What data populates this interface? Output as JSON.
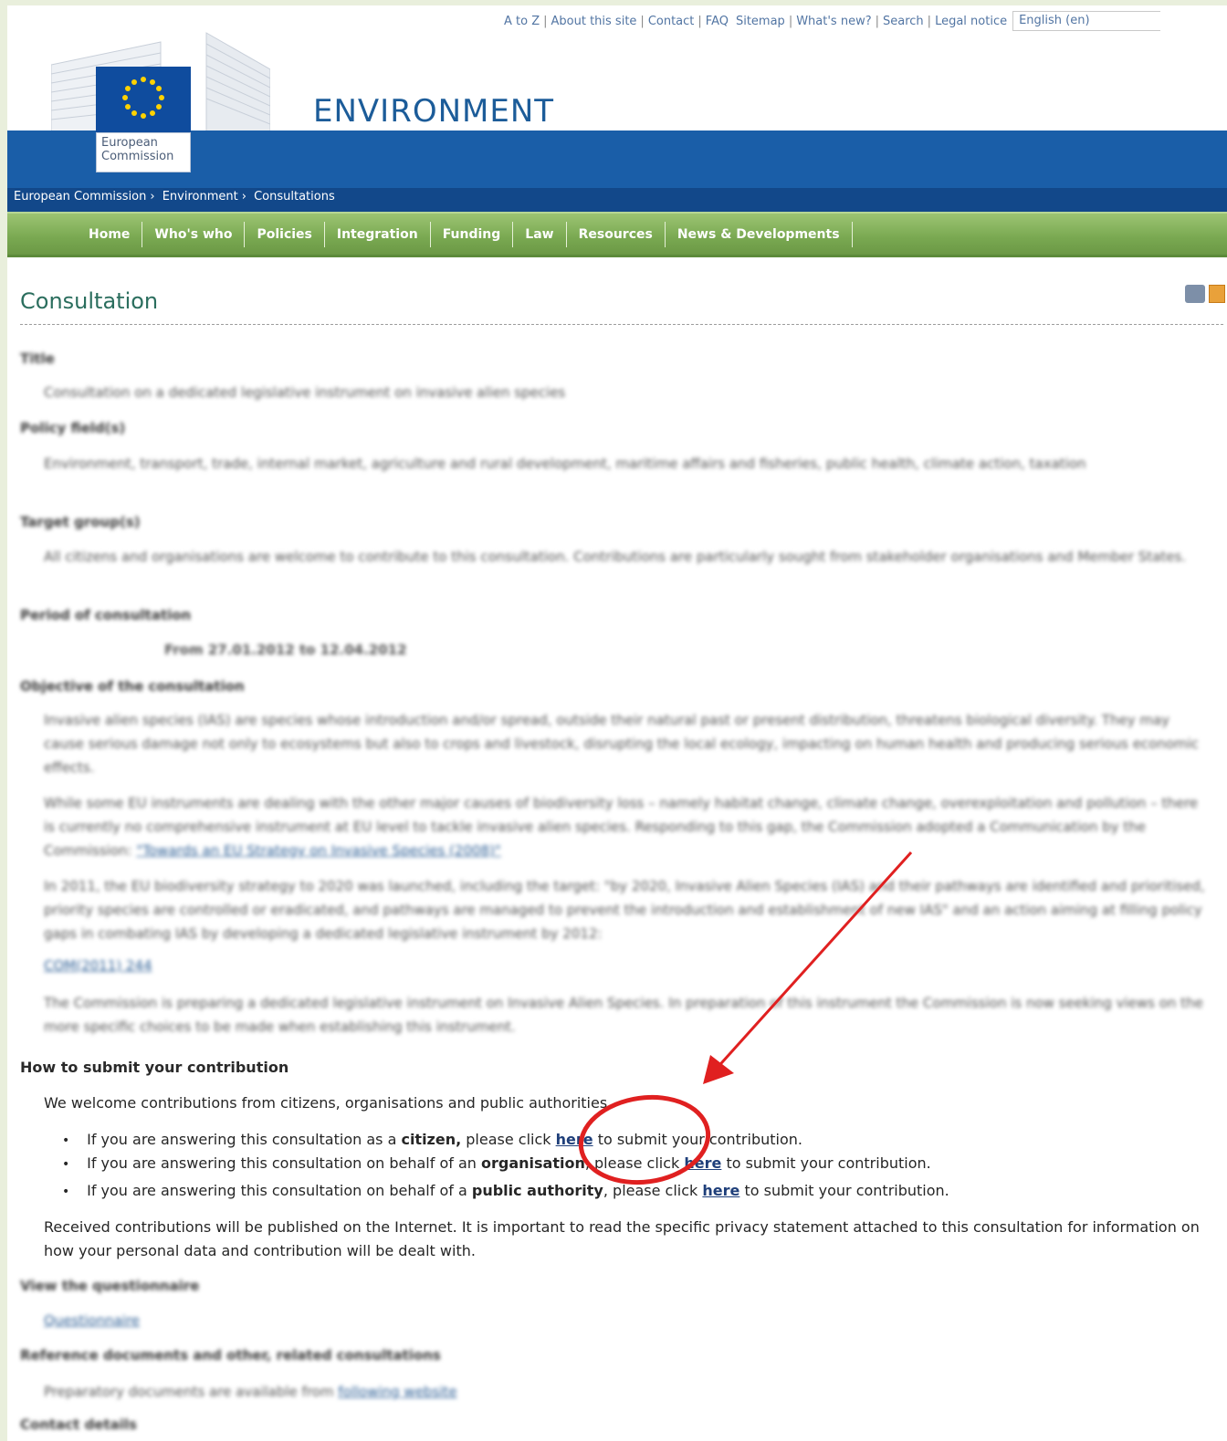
{
  "toplinks": {
    "items": [
      "A to Z",
      "About this site",
      "Contact",
      "FAQ",
      "Sitemap",
      "What's new?",
      "Search",
      "Legal notice"
    ],
    "language": "English (en)"
  },
  "header": {
    "logo_line1": "European",
    "logo_line2": "Commission",
    "site_title": "ENVIRONMENT"
  },
  "breadcrumb": [
    "European Commission",
    "Environment",
    "Consultations"
  ],
  "nav": [
    "Home",
    "Who's who",
    "Policies",
    "Integration",
    "Funding",
    "Law",
    "Resources",
    "News & Developments"
  ],
  "page": {
    "heading": "Consultation"
  },
  "blurred": {
    "title_label": "Title",
    "title_text": "Consultation on a dedicated legislative instrument on invasive alien species",
    "policy_label": "Policy field(s)",
    "policy_text": "Environment, transport, trade, internal market, agriculture and rural development, maritime affairs and fisheries, public health, climate action, taxation",
    "target_label": "Target group(s)",
    "target_text": "All citizens and organisations are welcome to contribute to this consultation. Contributions are particularly sought from stakeholder organisations and Member States.",
    "period_label": "Period of consultation",
    "period_text": "From 27.01.2012 to 12.04.2012",
    "objective_label": "Objective of the consultation",
    "objective_p1": "Invasive alien species (IAS) are species whose introduction and/or spread, outside their natural past or present distribution, threatens biological diversity. They may cause serious damage not only to ecosystems but also to crops and livestock, disrupting the local ecology, impacting on human health and producing serious economic effects.",
    "objective_p2": "While some EU instruments are dealing with the other major causes of biodiversity loss – namely habitat change, climate change, overexploitation and pollution – there is currently no comprehensive instrument at EU level to tackle invasive alien species. Responding to this gap, the Commission adopted a Communication by the Commission: ",
    "objective_p2_link": "\"Towards an EU Strategy on Invasive Species (2008)\"",
    "objective_p3": "In 2011, the EU biodiversity strategy to 2020 was launched, including the target: \"by 2020, Invasive Alien Species (IAS) and their pathways are identified and prioritised, priority species are controlled or eradicated, and pathways are managed to prevent the introduction and establishment of new IAS\" and an action aiming at filling policy gaps in combating IAS by developing a dedicated legislative instrument by 2012:",
    "objective_p3_link": "COM(2011) 244",
    "objective_p4": "The Commission is preparing a dedicated legislative instrument on Invasive Alien Species. In preparation of this instrument the Commission is now seeking views on the more specific choices to be made when establishing this instrument.",
    "questionnaire_label": "View the questionnaire",
    "questionnaire_link": "Questionnaire",
    "reference_label": "Reference documents and other, related consultations",
    "reference_text": "Preparatory documents are available from ",
    "reference_link": "following website",
    "contact_label": "Contact details"
  },
  "submit": {
    "title": "How to submit your contribution",
    "welcome": "We welcome contributions from citizens, organisations and public authorities.",
    "bullets": [
      {
        "pre": "If you are answering this consultation as a ",
        "bold": "citizen,",
        "mid": " please click ",
        "link": "here",
        "post": " to submit your contribution."
      },
      {
        "pre": "If you are answering this consultation on behalf of an ",
        "bold": "organisation",
        "mid": ", please click ",
        "link": "here",
        "post": " to submit your contribution."
      },
      {
        "pre": "If you are answering this consultation on behalf of a ",
        "bold": "public authority",
        "mid": ", please click ",
        "link": "here",
        "post": " to submit your contribution."
      }
    ],
    "received": "Received contributions will be published on the Internet. It is important to read the specific privacy statement attached to this consultation for information on how your personal data and contribution will be dealt with."
  },
  "colors": {
    "annotation": "#e02020",
    "nav_green": "#79a851",
    "band_blue": "#1a5ea8"
  }
}
